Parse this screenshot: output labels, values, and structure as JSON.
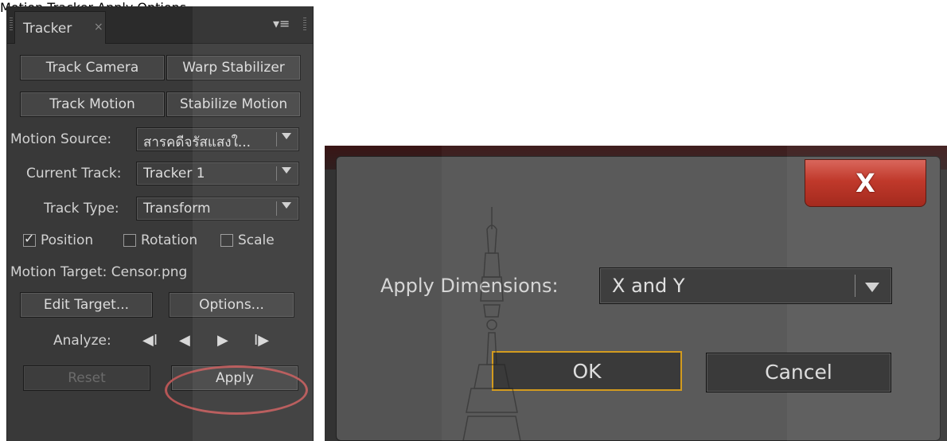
{
  "tracker": {
    "tab_label": "Tracker",
    "tab_close": "×",
    "menu_icon": "▾≡",
    "buttons": {
      "track_camera": "Track Camera",
      "warp_stabilizer": "Warp Stabilizer",
      "track_motion": "Track Motion",
      "stabilize_motion": "Stabilize Motion"
    },
    "motion_source": {
      "label": "Motion Source:",
      "value": "สารคดีจรัสแสงใ..."
    },
    "current_track": {
      "label": "Current Track:",
      "value": "Tracker 1"
    },
    "track_type": {
      "label": "Track Type:",
      "value": "Transform"
    },
    "checkboxes": {
      "position": {
        "label": "Position",
        "checked": true
      },
      "rotation": {
        "label": "Rotation",
        "checked": false
      },
      "scale": {
        "label": "Scale",
        "checked": false
      }
    },
    "motion_target": "Motion Target: Censor.png",
    "edit_target": "Edit Target...",
    "options": "Options...",
    "analyze_label": "Analyze:",
    "transport": {
      "step_back": "◀I",
      "back": "◀",
      "forward": "▶",
      "step_forward": "I▶"
    },
    "reset": "Reset",
    "apply": "Apply"
  },
  "dialog": {
    "title": "Motion Tracker Apply Options",
    "close_label": "X",
    "apply_dimensions_label": "Apply Dimensions:",
    "apply_dimensions_value": "X and Y",
    "ok": "OK",
    "cancel": "Cancel"
  },
  "colors": {
    "panel_bg": "#393939",
    "close_red": "#c0392b",
    "focus_outline": "#d39b1f",
    "annotation_circle": "#b65656"
  }
}
